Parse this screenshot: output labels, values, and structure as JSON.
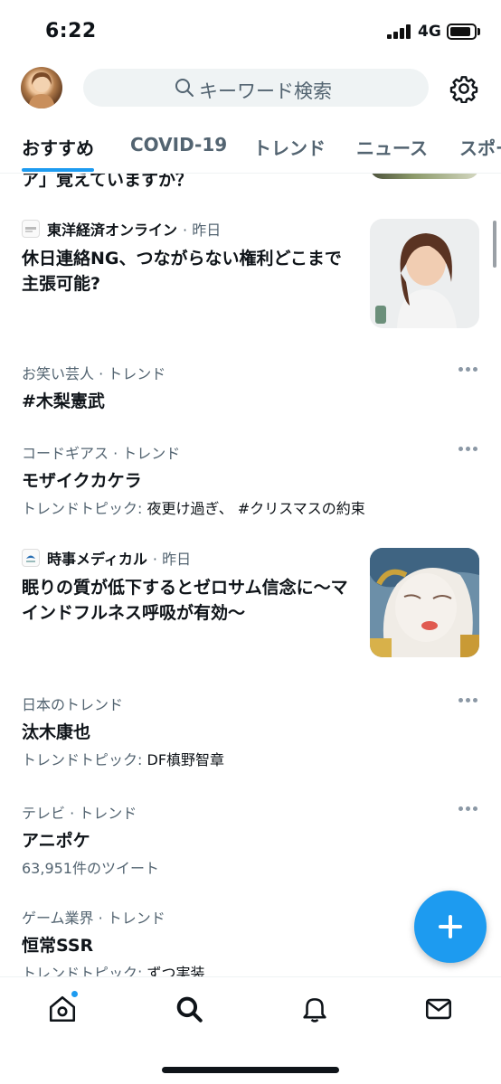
{
  "status_bar": {
    "time": "6:22",
    "network": "4G"
  },
  "header": {
    "search_placeholder": "キーワード検索"
  },
  "tabs": [
    {
      "label": "おすすめ",
      "active": true
    },
    {
      "label": "COVID-19",
      "active": false
    },
    {
      "label": "トレンド",
      "active": false
    },
    {
      "label": "ニュース",
      "active": false
    },
    {
      "label": "スポー",
      "active": false
    }
  ],
  "feed": {
    "partial_headline": "ア」覚えていますか？",
    "news": [
      {
        "source": "東洋経済オンライン",
        "time": "· 昨日",
        "headline": "休日連絡NG、つながらない権利どこまで主張可能?"
      },
      {
        "source": "時事メディカル",
        "time": "· 昨日",
        "headline": "眠りの質が低下するとゼロサム信念に〜マインドフルネス呼吸が有効〜"
      }
    ],
    "trends": [
      {
        "context": "お笑い芸人 · トレンド",
        "name": "#木梨憲武",
        "meta_prefix": "",
        "meta_topics": ""
      },
      {
        "context": "コードギアス · トレンド",
        "name": "モザイクカケラ",
        "meta_prefix": "トレンドトピック:",
        "meta_topics": "夜更け過ぎ、 #クリスマスの約束"
      },
      {
        "context": "日本のトレンド",
        "name": "汰木康也",
        "meta_prefix": "トレンドトピック:",
        "meta_topics": "DF槙野智章"
      },
      {
        "context": "テレビ · トレンド",
        "name": "アニポケ",
        "meta_prefix": "63,951件のツイート",
        "meta_topics": ""
      },
      {
        "context": "ゲーム業界 · トレンド",
        "name": "恒常SSR",
        "meta_prefix": "トレンドトピック:",
        "meta_topics": "ずつ実装"
      }
    ]
  },
  "bottom_nav": {
    "items": [
      "home-icon",
      "search-icon",
      "notifications-icon",
      "messages-icon"
    ],
    "active": "search-icon"
  },
  "colors": {
    "accent": "#1d9bf0",
    "secondary_text": "#536471"
  }
}
